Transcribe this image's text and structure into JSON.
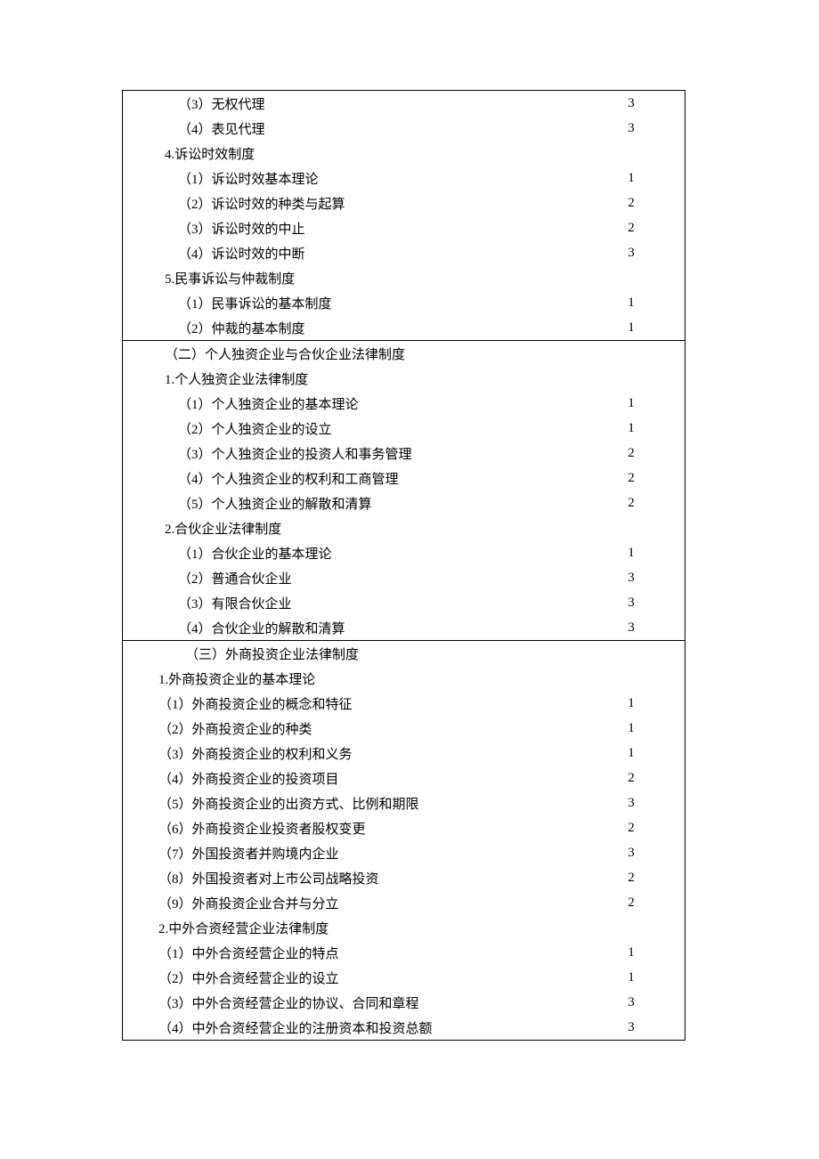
{
  "sections": [
    {
      "rows": [
        {
          "text": "（3）无权代理",
          "num": "3",
          "indent": "indent-item"
        },
        {
          "text": "（4）表见代理",
          "num": "3",
          "indent": "indent-item"
        },
        {
          "text": "4.诉讼时效制度",
          "num": "",
          "indent": "indent-sub"
        },
        {
          "text": "（1）诉讼时效基本理论",
          "num": "1",
          "indent": "indent-item"
        },
        {
          "text": "（2）诉讼时效的种类与起算",
          "num": "2",
          "indent": "indent-item"
        },
        {
          "text": "（3）诉讼时效的中止",
          "num": "2",
          "indent": "indent-item"
        },
        {
          "text": "（4）诉讼时效的中断",
          "num": "3",
          "indent": "indent-item"
        },
        {
          "text": "5.民事诉讼与仲裁制度",
          "num": "",
          "indent": "indent-sub"
        },
        {
          "text": "（1）民事诉讼的基本制度",
          "num": "1",
          "indent": "indent-item"
        },
        {
          "text": "（2）仲裁的基本制度",
          "num": "1",
          "indent": "indent-item"
        }
      ]
    },
    {
      "rows": [
        {
          "text": "（二）个人独资企业与合伙企业法律制度",
          "num": "",
          "indent": "indent-head"
        },
        {
          "text": "1.个人独资企业法律制度",
          "num": "",
          "indent": "indent-sub"
        },
        {
          "text": "（1）个人独资企业的基本理论",
          "num": "1",
          "indent": "indent-item"
        },
        {
          "text": "（2）个人独资企业的设立",
          "num": "1",
          "indent": "indent-item"
        },
        {
          "text": "（3）个人独资企业的投资人和事务管理",
          "num": "2",
          "indent": "indent-item"
        },
        {
          "text": "（4）个人独资企业的权利和工商管理",
          "num": "2",
          "indent": "indent-item"
        },
        {
          "text": "（5）个人独资企业的解散和清算",
          "num": "2",
          "indent": "indent-item"
        },
        {
          "text": "2.合伙企业法律制度",
          "num": "",
          "indent": "indent-sub"
        },
        {
          "text": "（1）合伙企业的基本理论",
          "num": "1",
          "indent": "indent-item"
        },
        {
          "text": "（2）普通合伙企业",
          "num": "3",
          "indent": "indent-item"
        },
        {
          "text": "（3）有限合伙企业",
          "num": "3",
          "indent": "indent-item"
        },
        {
          "text": "（4）合伙企业的解散和清算",
          "num": "3",
          "indent": "indent-item"
        }
      ]
    },
    {
      "rows": [
        {
          "text": "（三）外商投资企业法律制度",
          "num": "",
          "indent": "indent-head2"
        },
        {
          "text": "1.外商投资企业的基本理论",
          "num": "",
          "indent": "indent-sub2"
        },
        {
          "text": "（1）外商投资企业的概念和特征",
          "num": "1",
          "indent": "indent-sub2"
        },
        {
          "text": "（2）外商投资企业的种类",
          "num": "1",
          "indent": "indent-sub2"
        },
        {
          "text": "（3）外商投资企业的权利和义务",
          "num": "1",
          "indent": "indent-sub2"
        },
        {
          "text": "（4）外商投资企业的投资项目",
          "num": "2",
          "indent": "indent-sub2"
        },
        {
          "text": "（5）外商投资企业的出资方式、比例和期限",
          "num": "3",
          "indent": "indent-sub2"
        },
        {
          "text": "（6）外商投资企业投资者股权变更",
          "num": "2",
          "indent": "indent-sub2"
        },
        {
          "text": "（7）外国投资者并购境内企业",
          "num": "3",
          "indent": "indent-sub2"
        },
        {
          "text": "（8）外国投资者对上市公司战略投资",
          "num": "2",
          "indent": "indent-sub2"
        },
        {
          "text": "（9）外商投资企业合并与分立",
          "num": "2",
          "indent": "indent-sub2"
        },
        {
          "text": "2.中外合资经营企业法律制度",
          "num": "",
          "indent": "indent-sub2"
        },
        {
          "text": "（1）中外合资经营企业的特点",
          "num": "1",
          "indent": "indent-sub2"
        },
        {
          "text": "（2）中外合资经营企业的设立",
          "num": "1",
          "indent": "indent-sub2"
        },
        {
          "text": "（3）中外合资经营企业的协议、合同和章程",
          "num": "3",
          "indent": "indent-sub2"
        },
        {
          "text": "（4）中外合资经营企业的注册资本和投资总额",
          "num": "3",
          "indent": "indent-sub2"
        }
      ]
    }
  ]
}
